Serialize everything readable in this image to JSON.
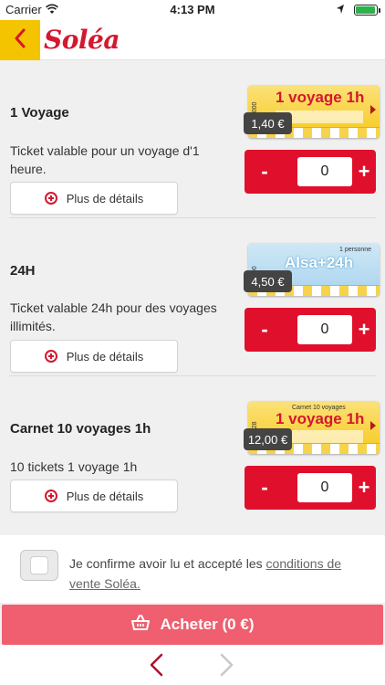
{
  "status_bar": {
    "carrier": "Carrier",
    "time": "4:13 PM"
  },
  "header": {
    "logo": "Soléa"
  },
  "products": [
    {
      "name": "1 Voyage",
      "description": "Ticket valable pour un voyage d'1 heure.",
      "details_label": "Plus de détails",
      "price": "1,40 €",
      "quantity": "0",
      "ticket_title": "1 voyage 1h",
      "ticket_subtitle": "",
      "ticket_serial": "N° 0000"
    },
    {
      "name": "24H",
      "description": "Ticket valable 24h pour des voyages illimités.",
      "details_label": "Plus de détails",
      "price": "4,50 €",
      "quantity": "0",
      "ticket_title": "Alsa+24h",
      "ticket_subtitle": "1 personne",
      "ticket_serial": "AA 00"
    },
    {
      "name": "Carnet 10 voyages 1h",
      "description": "10 tickets 1 voyage 1h",
      "details_label": "Plus de détails",
      "price": "12,00 €",
      "quantity": "0",
      "ticket_title": "1 voyage 1h",
      "ticket_subtitle": "Carnet 10 voyages",
      "ticket_serial": "N° 128"
    }
  ],
  "stepper": {
    "minus": "-",
    "plus": "+"
  },
  "confirm": {
    "text": "Je confirme avoir lu et accepté les ",
    "link": "conditions de vente Soléa."
  },
  "buy_button": {
    "label": "Acheter (0 €)"
  },
  "colors": {
    "brand_red": "#e0102c",
    "brand_yellow": "#f5c400",
    "buy_button": "#ef5f6f"
  },
  "icons": {
    "back": "chevron-left-icon",
    "details": "plus-circle-icon",
    "basket": "basket-icon",
    "nav_prev": "chevron-left-icon",
    "nav_next": "chevron-right-icon"
  }
}
